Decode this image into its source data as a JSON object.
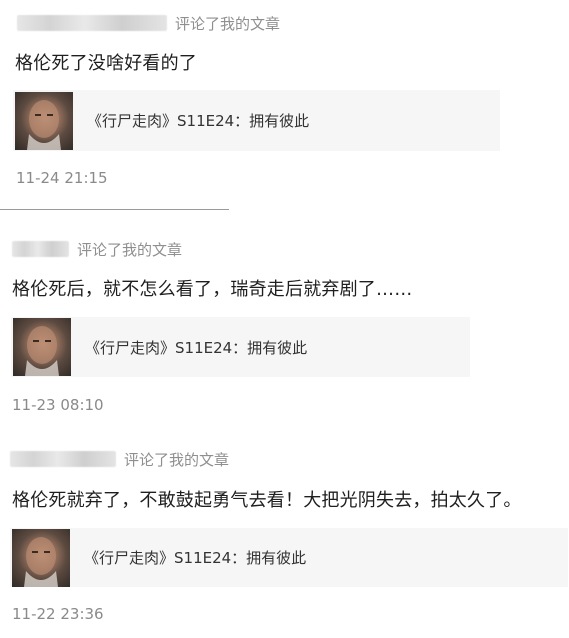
{
  "comments": [
    {
      "action": "评论了我的文章",
      "text": "格伦死了没啥好看的了",
      "card_title": "《行尸走肉》S11E24：拥有彼此",
      "time": "11-24 21:15"
    },
    {
      "action": "评论了我的文章",
      "text": "格伦死后，就不怎么看了，瑞奇走后就弃剧了……",
      "card_title": "《行尸走肉》S11E24：拥有彼此",
      "time": "11-23 08:10"
    },
    {
      "action": "评论了我的文章",
      "text": "格伦死就弃了，不敢鼓起勇气去看！大把光阴失去，拍太久了。",
      "card_title": "《行尸走肉》S11E24：拥有彼此",
      "time": "11-22 23:36"
    }
  ]
}
